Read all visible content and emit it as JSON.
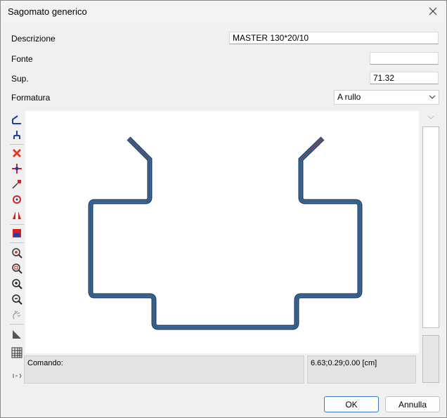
{
  "window": {
    "title": "Sagomato generico"
  },
  "form": {
    "descrizione_label": "Descrizione",
    "descrizione_value": "MASTER 130*20/10",
    "fonte_label": "Fonte",
    "fonte_value": "",
    "sup_label": "Sup.",
    "sup_value": "71.32",
    "formatura_label": "Formatura",
    "formatura_value": "A rullo"
  },
  "toolbar": {
    "items": [
      "draw-profile-icon",
      "fork-node-icon",
      "delete-icon",
      "move-icon",
      "scale-icon",
      "rotate-icon",
      "mirror-icon",
      "pdf-export-icon",
      "zoom-in-icon",
      "zoom-window-icon",
      "zoom-plus-icon",
      "zoom-minus-icon",
      "pan-hand-icon",
      "measure-angle-icon",
      "grid-icon",
      "more-icon"
    ]
  },
  "status": {
    "command_label": "Comando:",
    "coordinates": "6.63;0.29;0.00 [cm]"
  },
  "buttons": {
    "ok": "OK",
    "cancel": "Annulla"
  },
  "colors": {
    "profile_blue": "#3d6fa5",
    "profile_edge_red": "#e0303a",
    "accent": "#3a78c8"
  }
}
